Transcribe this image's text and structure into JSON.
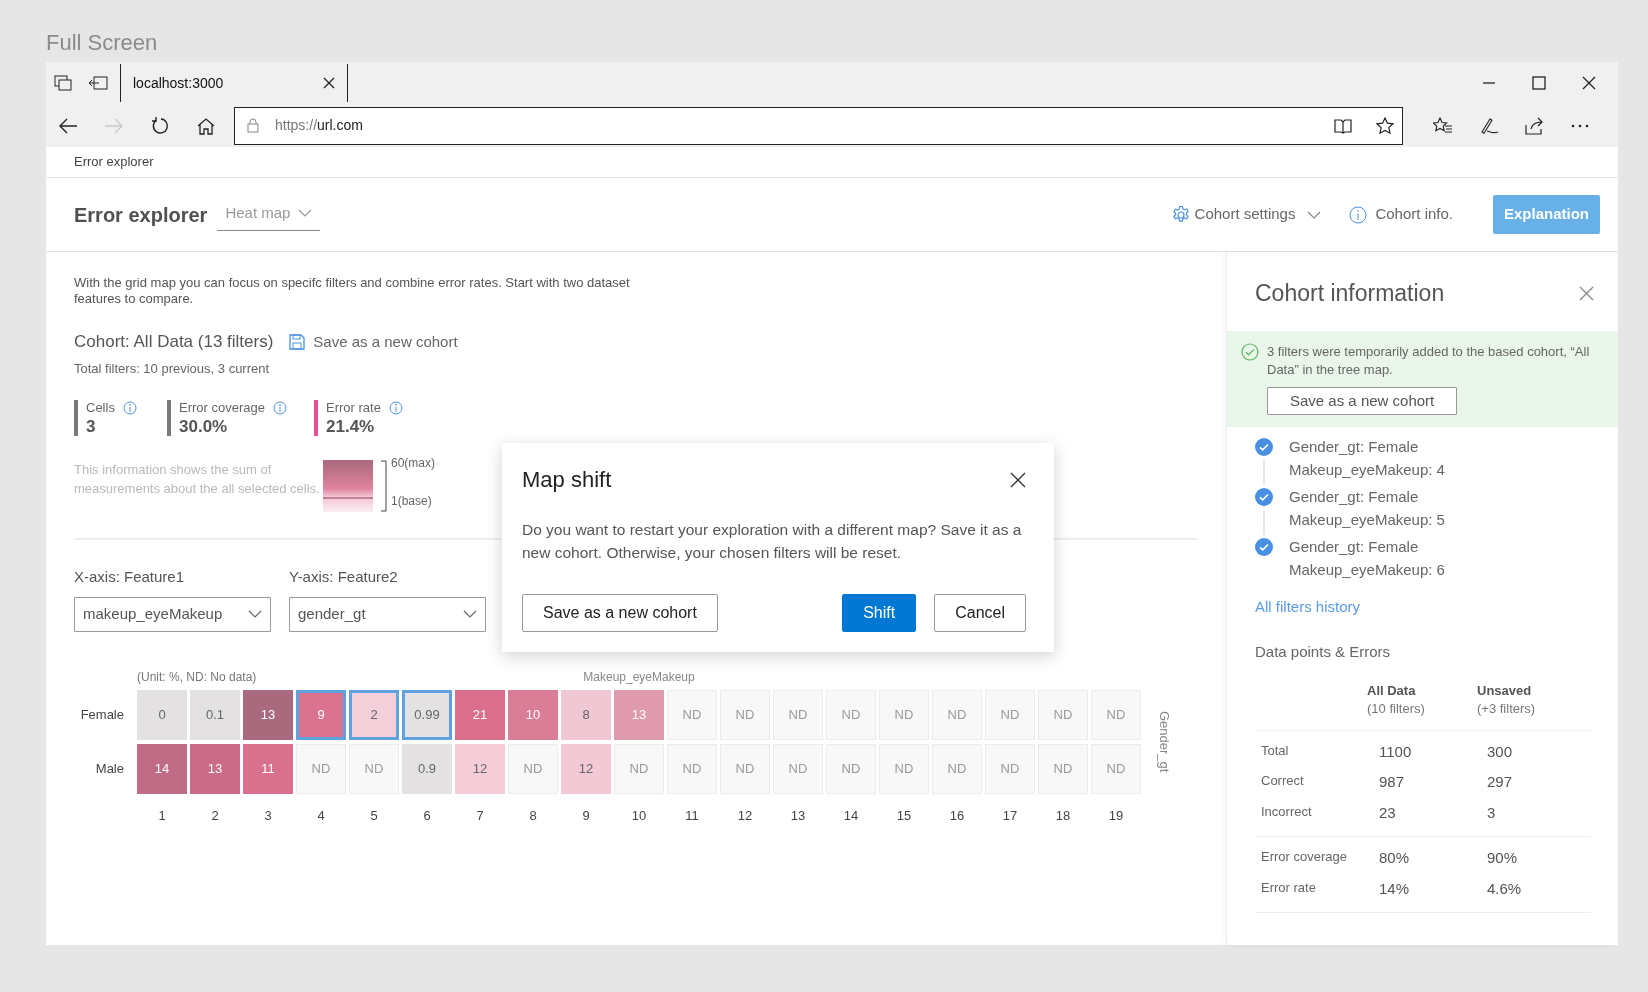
{
  "screen_label": "Full Screen",
  "browser": {
    "tab": {
      "title": "localhost:3000"
    },
    "nav": [
      {
        "kind": "back",
        "disabled": false
      },
      {
        "kind": "forward",
        "disabled": true
      },
      {
        "kind": "refresh",
        "disabled": false
      },
      {
        "kind": "home",
        "disabled": false
      }
    ],
    "address": {
      "scheme": "https://",
      "host": "url.com"
    }
  },
  "breadcrumb": "Error explorer",
  "header": {
    "title": "Error explorer",
    "view_dropdown": "Heat map",
    "actions": [
      {
        "kind": "settings",
        "label": "Cohort settings"
      },
      {
        "kind": "info",
        "label": "Cohort info."
      },
      {
        "kind": "primary",
        "label": "Explanation"
      }
    ]
  },
  "intro": "With the grid map you can focus on specifc filters and combine error rates. Start with two dataset features to compare.",
  "cohort": {
    "title": "Cohort: All Data (13 filters)",
    "save_link": "Save as a new cohort",
    "subtitle": "Total filters: 10 previous, 3 current"
  },
  "metrics": [
    {
      "label": "Cells",
      "value": "3",
      "color": "#7a7a7a"
    },
    {
      "label": "Error coverage",
      "value": "30.0%",
      "color": "#7a7a7a"
    },
    {
      "label": "Error rate",
      "value": "21.4%",
      "color": "#e8509a"
    }
  ],
  "metrics_note": "This information shows the sum of measurements about the all selected cells.",
  "legend": {
    "max": "60(max)",
    "base": "1(base)"
  },
  "axes": [
    {
      "label": "X-axis: Feature1",
      "value": "makeup_eyeMakeup"
    },
    {
      "label": "Y-axis: Feature2",
      "value": "gender_gt"
    }
  ],
  "heatmap": {
    "unit_note": "(Unit: %, ND: No data)",
    "x_title": "Makeup_eyeMakeup",
    "y_title": "Gender_gt",
    "rows": [
      {
        "label": "Female",
        "cells": [
          {
            "text": "0",
            "color": "#e3e1e1",
            "selected": false
          },
          {
            "text": "0.1",
            "color": "#e3e1e1",
            "selected": false
          },
          {
            "text": "13",
            "color": "#a86a7c",
            "selected": false
          },
          {
            "text": "9",
            "color": "#d9718f",
            "selected": true
          },
          {
            "text": "2",
            "color": "#f3cfd9",
            "selected": true
          },
          {
            "text": "0.99",
            "color": "#e3e1e1",
            "selected": true
          },
          {
            "text": "21",
            "color": "#d96f8d",
            "selected": false
          },
          {
            "text": "10",
            "color": "#da7d97",
            "selected": false
          },
          {
            "text": "8",
            "color": "#f0c8d4",
            "selected": false
          },
          {
            "text": "13",
            "color": "#e09aae",
            "selected": false
          },
          {
            "text": "ND",
            "color": "#f8f8f8",
            "selected": false
          },
          {
            "text": "ND",
            "color": "#f8f8f8",
            "selected": false
          },
          {
            "text": "ND",
            "color": "#f8f8f8",
            "selected": false
          },
          {
            "text": "ND",
            "color": "#f8f8f8",
            "selected": false
          },
          {
            "text": "ND",
            "color": "#f8f8f8",
            "selected": false
          },
          {
            "text": "ND",
            "color": "#f8f8f8",
            "selected": false
          },
          {
            "text": "ND",
            "color": "#f8f8f8",
            "selected": false
          },
          {
            "text": "ND",
            "color": "#f8f8f8",
            "selected": false
          },
          {
            "text": "ND",
            "color": "#f8f8f8",
            "selected": false
          }
        ]
      },
      {
        "label": "Male",
        "cells": [
          {
            "text": "14",
            "color": "#c06b85",
            "selected": false
          },
          {
            "text": "13",
            "color": "#cc6b88",
            "selected": false
          },
          {
            "text": "11",
            "color": "#d9708e",
            "selected": false
          },
          {
            "text": "ND",
            "color": "#f8f8f8",
            "selected": false
          },
          {
            "text": "ND",
            "color": "#f8f8f8",
            "selected": false
          },
          {
            "text": "0.9",
            "color": "#e3e1e1",
            "selected": false
          },
          {
            "text": "12",
            "color": "#f4cdd9",
            "selected": false
          },
          {
            "text": "ND",
            "color": "#f8f8f8",
            "selected": false
          },
          {
            "text": "12",
            "color": "#f2c9d5",
            "selected": false
          },
          {
            "text": "ND",
            "color": "#f8f8f8",
            "selected": false
          },
          {
            "text": "ND",
            "color": "#f8f8f8",
            "selected": false
          },
          {
            "text": "ND",
            "color": "#f8f8f8",
            "selected": false
          },
          {
            "text": "ND",
            "color": "#f8f8f8",
            "selected": false
          },
          {
            "text": "ND",
            "color": "#f8f8f8",
            "selected": false
          },
          {
            "text": "ND",
            "color": "#f8f8f8",
            "selected": false
          },
          {
            "text": "ND",
            "color": "#f8f8f8",
            "selected": false
          },
          {
            "text": "ND",
            "color": "#f8f8f8",
            "selected": false
          },
          {
            "text": "ND",
            "color": "#f8f8f8",
            "selected": false
          },
          {
            "text": "ND",
            "color": "#f8f8f8",
            "selected": false
          }
        ]
      }
    ],
    "x_labels": [
      "1",
      "2",
      "3",
      "4",
      "5",
      "6",
      "7",
      "8",
      "9",
      "10",
      "11",
      "12",
      "13",
      "14",
      "15",
      "16",
      "17",
      "18",
      "19"
    ]
  },
  "cohort_panel": {
    "title": "Cohort information",
    "notice": {
      "text": "3 filters were temporarily added to the based cohort, “All Data” in the tree map.",
      "button": "Save as a new cohort"
    },
    "filters": [
      {
        "lines": [
          "Gender_gt: Female",
          "Makeup_eyeMakeup: 4"
        ],
        "checked": true
      },
      {
        "lines": [
          "Gender_gt: Female",
          "Makeup_eyeMakeup: 5"
        ],
        "checked": true
      },
      {
        "lines": [
          "Gender_gt: Female",
          "Makeup_eyeMakeup: 6"
        ],
        "checked": true
      }
    ],
    "history_link": "All filters history",
    "stats_title": "Data points & Errors",
    "stats_columns": [
      {
        "title": "All Data",
        "sub": "(10 filters)"
      },
      {
        "title": "Unsaved",
        "sub": "(+3 filters)"
      }
    ],
    "stats_groups": [
      [
        {
          "label": "Total",
          "values": [
            "1100",
            "300"
          ]
        },
        {
          "label": "Correct",
          "values": [
            "987",
            "297"
          ]
        },
        {
          "label": "Incorrect",
          "values": [
            "23",
            "3"
          ]
        }
      ],
      [
        {
          "label": "Error coverage",
          "values": [
            "80%",
            "90%"
          ]
        },
        {
          "label": "Error rate",
          "values": [
            "14%",
            "4.6%"
          ]
        }
      ]
    ]
  },
  "dialog": {
    "title": "Map shift",
    "message": "Do you want to restart your exploration with a different map? Save it as a new cohort. Otherwise, your chosen filters will be reset.",
    "buttons": [
      {
        "kind": "secondary",
        "label": "Save as a new cohort"
      },
      {
        "kind": "primary",
        "label": "Shift"
      },
      {
        "kind": "secondary",
        "label": "Cancel"
      }
    ]
  }
}
